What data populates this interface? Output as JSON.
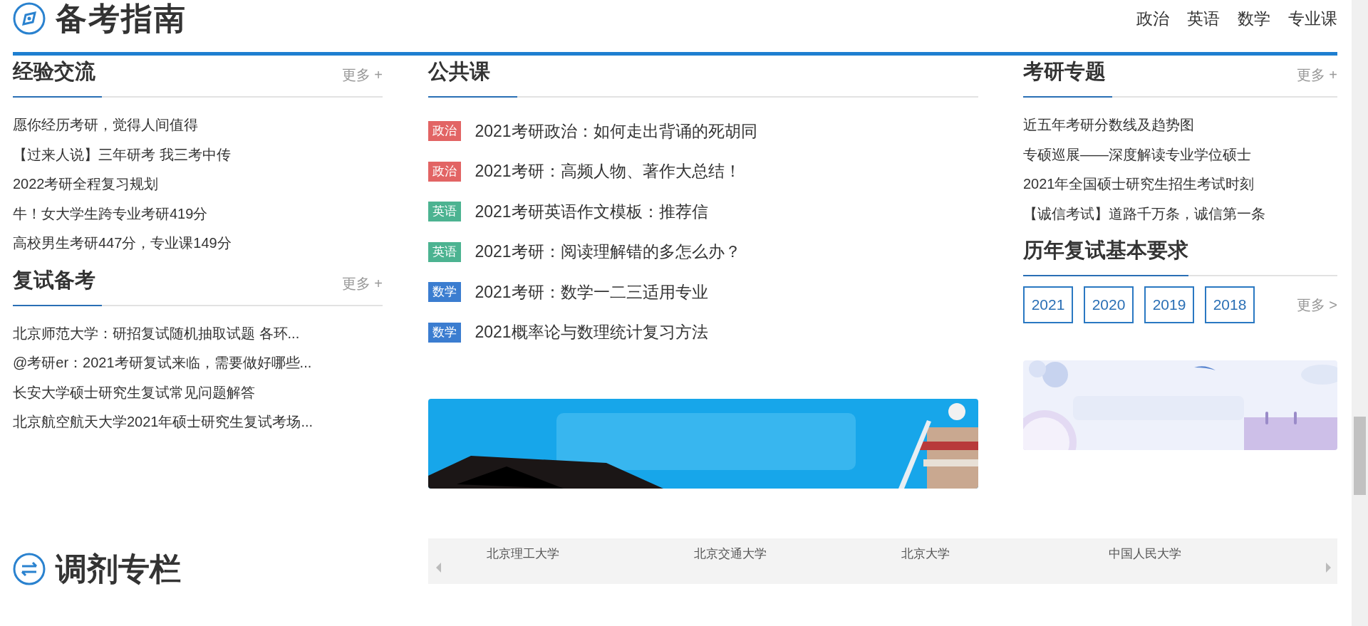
{
  "header": {
    "title": "备考指南",
    "nav": [
      "政治",
      "英语",
      "数学",
      "专业课"
    ]
  },
  "experience": {
    "title": "经验交流",
    "more": "更多",
    "more_icon": "+",
    "items": [
      "愿你经历考研，觉得人间值得",
      "【过来人说】三年研考 我三考中传",
      "2022考研全程复习规划",
      "牛！女大学生跨专业考研419分",
      "高校男生考研447分，专业课149分"
    ]
  },
  "retest": {
    "title": "复试备考",
    "more": "更多",
    "more_icon": "+",
    "items": [
      "北京师范大学：研招复试随机抽取试题 各环...",
      "@考研er：2021考研复试来临，需要做好哪些...",
      "长安大学硕士研究生复试常见问题解答",
      "北京航空航天大学2021年硕士研究生复试考场..."
    ]
  },
  "public_course": {
    "title": "公共课",
    "items": [
      {
        "tag": "政治",
        "color": "#e26464",
        "title": "2021考研政治：如何走出背诵的死胡同"
      },
      {
        "tag": "政治",
        "color": "#e26464",
        "title": "2021考研：高频人物、著作大总结！"
      },
      {
        "tag": "英语",
        "color": "#4cb391",
        "title": "2021考研英语作文模板：推荐信"
      },
      {
        "tag": "英语",
        "color": "#4cb391",
        "title": "2021考研：阅读理解错的多怎么办？"
      },
      {
        "tag": "数学",
        "color": "#3b7dd0",
        "title": "2021考研：数学一二三适用专业"
      },
      {
        "tag": "数学",
        "color": "#3b7dd0",
        "title": "2021概率论与数理统计复习方法"
      }
    ]
  },
  "topics": {
    "title": "考研专题",
    "more": "更多",
    "more_icon": "+",
    "items": [
      "近五年考研分数线及趋势图",
      "专硕巡展——深度解读专业学位硕士",
      "2021年全国硕士研究生招生考试时刻",
      "【诚信考试】道路千万条，诚信第一条"
    ]
  },
  "retest_requirements": {
    "title": "历年复试基本要求",
    "years": [
      "2021",
      "2020",
      "2019",
      "2018"
    ],
    "more": "更多",
    "more_icon": ">"
  },
  "adjustment": {
    "title": "调剂专栏",
    "universities": [
      "北京理工大学",
      "北京交通大学",
      "北京大学",
      "中国人民大学"
    ]
  }
}
